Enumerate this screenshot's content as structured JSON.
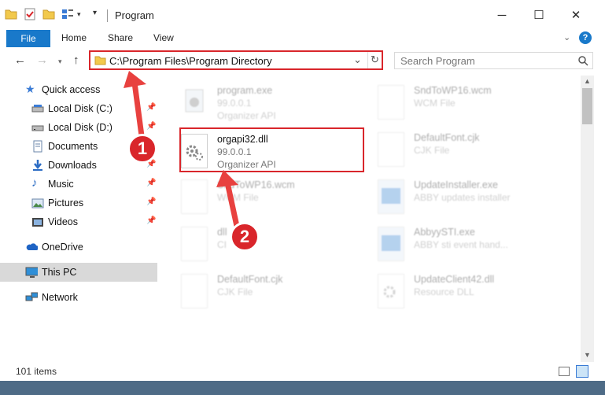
{
  "window": {
    "title": "Program"
  },
  "ribbon": {
    "tabs": [
      "File",
      "Home",
      "Share",
      "View"
    ]
  },
  "address": {
    "path": "C:\\Program Files\\Program Directory"
  },
  "search": {
    "placeholder": "Search Program"
  },
  "sidebar": {
    "items": [
      {
        "label": "Quick access",
        "icon": "star-icon"
      },
      {
        "label": "Local Disk (C:)",
        "icon": "drive-icon"
      },
      {
        "label": "Local Disk (D:)",
        "icon": "drive-icon"
      },
      {
        "label": "Documents",
        "icon": "documents-icon"
      },
      {
        "label": "Downloads",
        "icon": "download-icon"
      },
      {
        "label": "Music",
        "icon": "music-icon"
      },
      {
        "label": "Pictures",
        "icon": "pictures-icon"
      },
      {
        "label": "Videos",
        "icon": "videos-icon"
      },
      {
        "label": "OneDrive",
        "icon": "cloud-icon"
      },
      {
        "label": "This PC",
        "icon": "computer-icon"
      },
      {
        "label": "Network",
        "icon": "network-icon"
      }
    ]
  },
  "files": {
    "left": [
      {
        "name": "program.exe",
        "line1": "99.0.0.1",
        "line2": "Organizer API"
      },
      {
        "name": "orgapi32.dll",
        "line1": "99.0.0.1",
        "line2": "Organizer API"
      },
      {
        "name": "SndToWP16.wcm",
        "line1": "WCM File",
        "line2": ""
      },
      {
        "name": "dll",
        "line1": "CI",
        "line2": ""
      },
      {
        "name": "DefaultFont.cjk",
        "line1": "CJK File",
        "line2": ""
      }
    ],
    "right": [
      {
        "name": "SndToWP16.wcm",
        "line1": "WCM File",
        "line2": ""
      },
      {
        "name": "DefaultFont.cjk",
        "line1": "CJK File",
        "line2": ""
      },
      {
        "name": "UpdateInstaller.exe",
        "line1": "ABBY updates installer",
        "line2": ""
      },
      {
        "name": "AbbyySTI.exe",
        "line1": "ABBY sti event hand...",
        "line2": ""
      },
      {
        "name": "UpdateClient42.dll",
        "line1": "Resource DLL",
        "line2": ""
      }
    ]
  },
  "status": {
    "count": "101 items"
  },
  "badges": {
    "one": "1",
    "two": "2"
  },
  "colors": {
    "accent": "#1979ca",
    "highlight": "#d9262b"
  }
}
